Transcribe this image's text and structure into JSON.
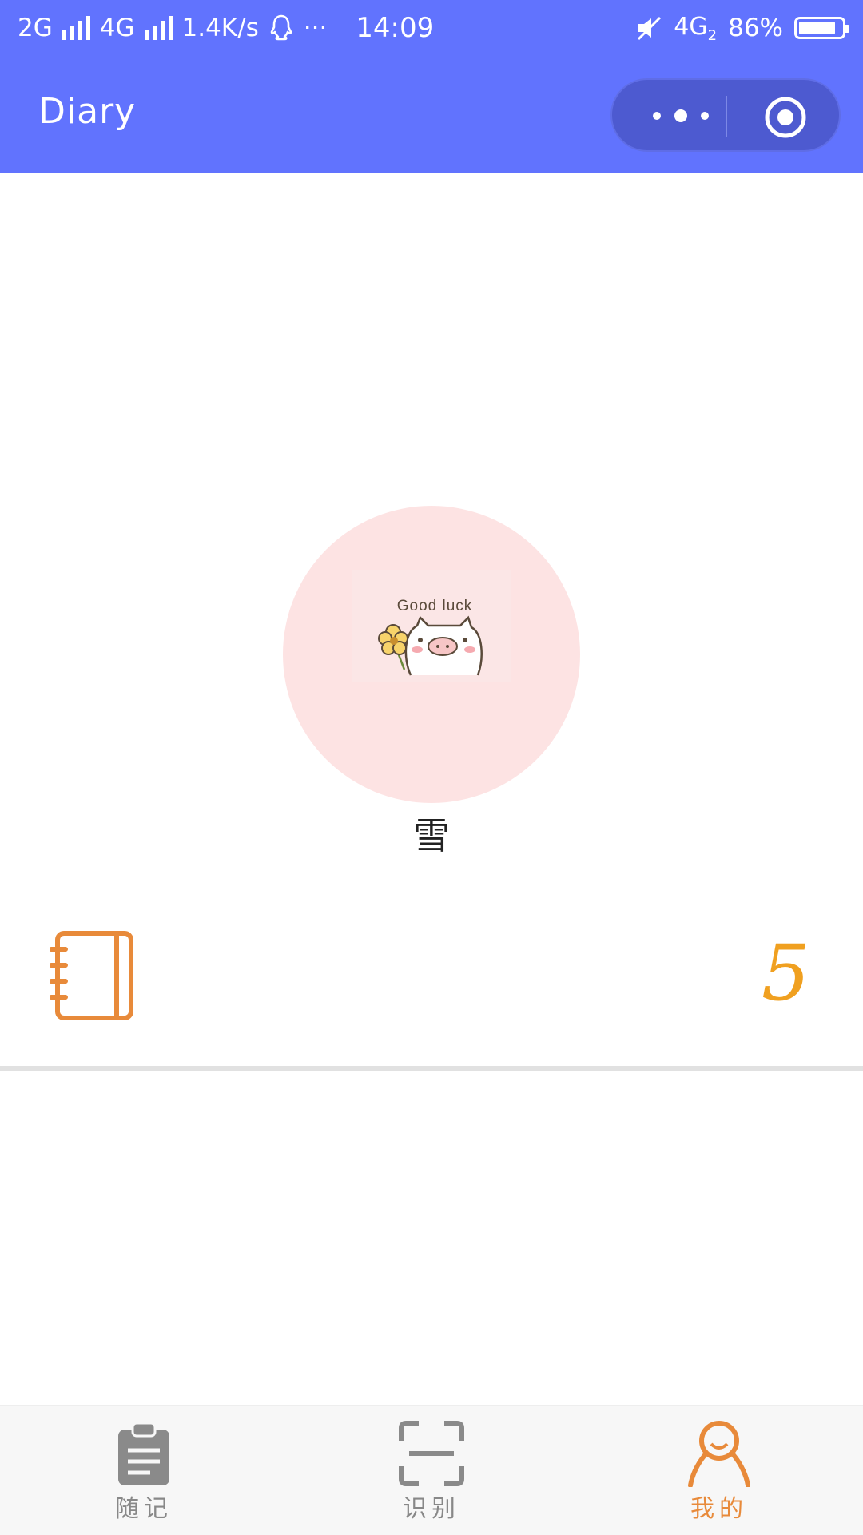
{
  "status_bar": {
    "network1": "2G",
    "network2": "4G",
    "speed": "1.4K/s",
    "extra": "···",
    "time": "14:09",
    "net_type": "4G",
    "sim_slot": "2",
    "battery": "86%",
    "battery_level": 0.86
  },
  "navbar": {
    "title": "Diary",
    "bg_color": "#6173fe"
  },
  "profile": {
    "avatar_text": "Good luck",
    "username": "雪"
  },
  "diary": {
    "count": "5",
    "icon": "notebook-icon",
    "accent": "#f0a020"
  },
  "tabbar": {
    "items": [
      {
        "label": "随记",
        "icon": "clipboard-icon",
        "active": false
      },
      {
        "label": "识别",
        "icon": "scan-icon",
        "active": false
      },
      {
        "label": "我的",
        "icon": "person-icon",
        "active": true
      }
    ],
    "active_color": "#e88a3a",
    "inactive_color": "#888888"
  }
}
